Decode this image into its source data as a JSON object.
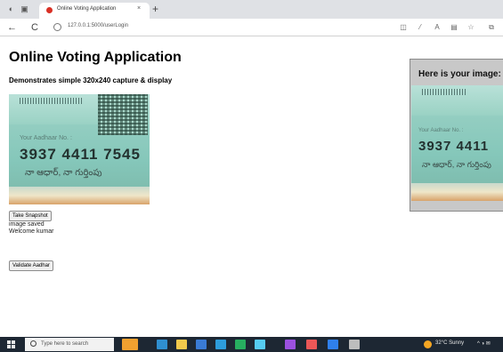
{
  "browser": {
    "tab_title": "Online Voting Application",
    "tab_close": "×",
    "new_tab": "+",
    "url": "127.0.0.1:5000/userLogin",
    "nav_back": "←",
    "nav_refresh": "C"
  },
  "page": {
    "title": "Online Voting Application",
    "subtitle": "Demonstrates simple 320x240 capture & display",
    "snapshot_button": "Take Snapshot",
    "status_line1": "image saved",
    "status_line2": "Welcome kumar",
    "validate_button": "Validate Aadhar"
  },
  "card": {
    "label": "Your Aadhaar No. :",
    "number": "3937 4411 7545",
    "name_line": "నా ఆధార్, నా గుర్తింపు"
  },
  "panel": {
    "heading": "Here is your image:",
    "number": "3937 4411"
  },
  "taskbar": {
    "search_placeholder": "Type here to search",
    "weather": "32°C Sunny"
  },
  "colors": {
    "tabbar": "#dfe1e5",
    "taskbar": "#1d2733",
    "panel_bg": "#c8c8c8",
    "card_teal": "#9fd3c7"
  }
}
